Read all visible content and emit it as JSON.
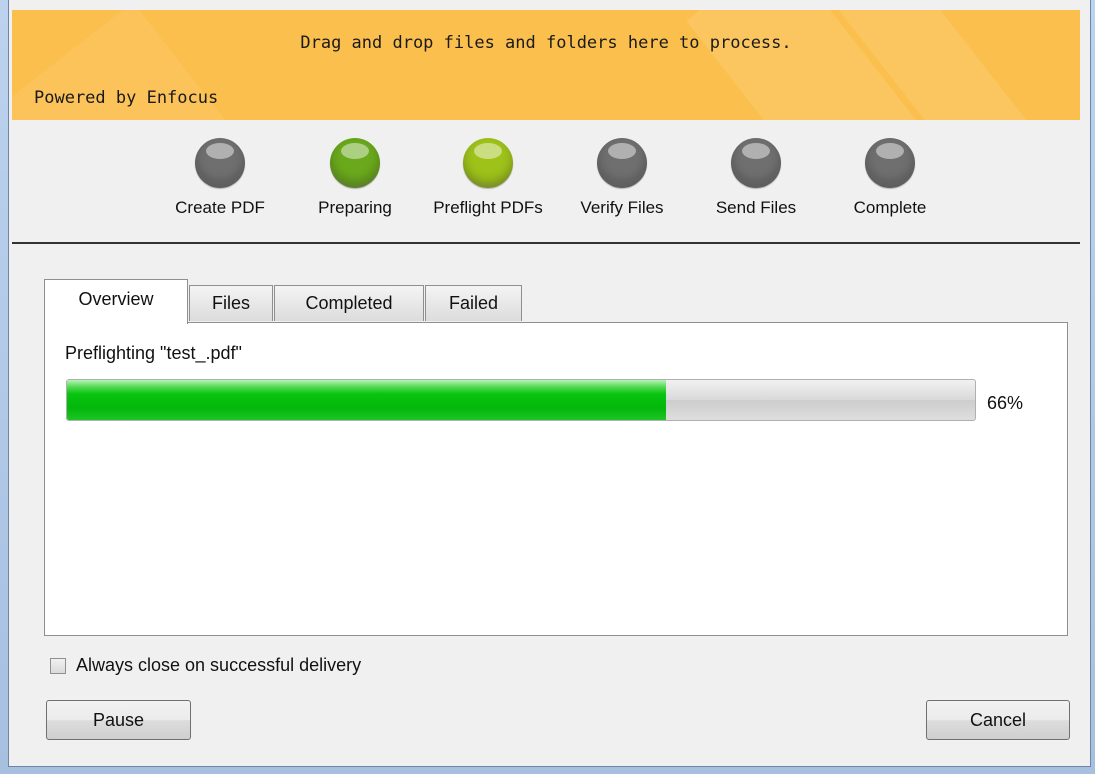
{
  "banner": {
    "drop_text": "Drag and drop files and folders here to process.",
    "powered_by": "Powered by Enfocus",
    "color": "#fbbf4e"
  },
  "steps": [
    {
      "label": "Create PDF",
      "state": "pending",
      "color": "#6f6f6f"
    },
    {
      "label": "Preparing",
      "state": "done",
      "color": "#6aa81c"
    },
    {
      "label": "Preflight PDFs",
      "state": "active",
      "color": "#9fc21a"
    },
    {
      "label": "Verify Files",
      "state": "pending",
      "color": "#6f6f6f"
    },
    {
      "label": "Send Files",
      "state": "pending",
      "color": "#6f6f6f"
    },
    {
      "label": "Complete",
      "state": "pending",
      "color": "#6f6f6f"
    }
  ],
  "tabs": [
    {
      "label": "Overview",
      "active": true
    },
    {
      "label": "Files",
      "active": false
    },
    {
      "label": "Completed",
      "active": false
    },
    {
      "label": "Failed",
      "active": false
    }
  ],
  "overview": {
    "status": "Preflighting \"test_.pdf\"",
    "progress_percent": 66,
    "progress_label": "66%",
    "progress_color": "#08c40f"
  },
  "options": {
    "always_close_label": "Always close on successful delivery",
    "always_close_checked": false
  },
  "buttons": {
    "pause": "Pause",
    "cancel": "Cancel"
  }
}
